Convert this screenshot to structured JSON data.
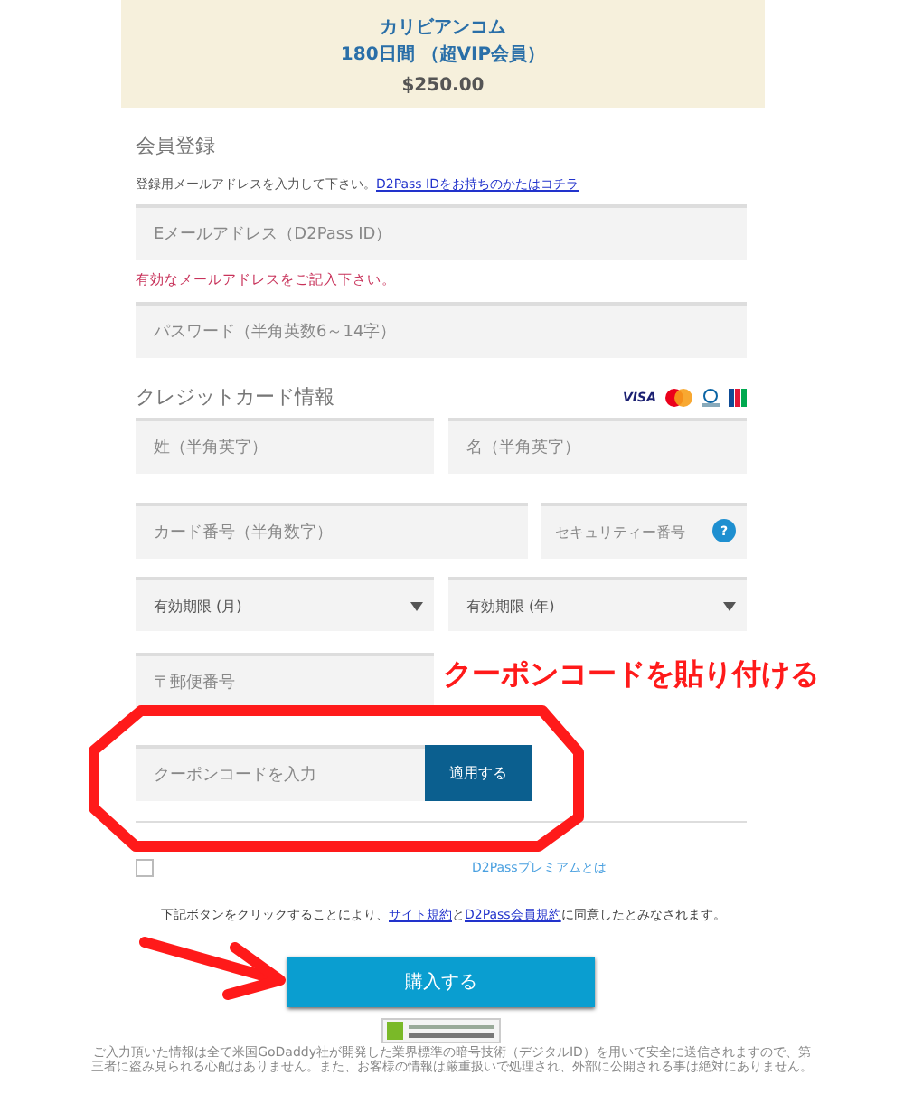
{
  "plan": {
    "site": "カリビアンコム",
    "term": "180日間 （超VIP会員）",
    "price": "$250.00"
  },
  "register": {
    "heading": "会員登録",
    "hint": "登録用メールアドレスを入力して下さい。",
    "hint_link": "D2Pass IDをお持ちのかたはコチラ",
    "email": {
      "placeholder": "Eメールアドレス（D2Pass ID）"
    },
    "error": "有効なメールアドレスをご記入下さい。",
    "password": {
      "placeholder": "パスワード（半角英数6～14字）"
    }
  },
  "card": {
    "heading": "クレジットカード情報",
    "visa": "VISA",
    "last_name": {
      "placeholder": "姓（半角英字）"
    },
    "first_name": {
      "placeholder": "名（半角英字）"
    },
    "number": {
      "placeholder": "カード番号（半角数字）"
    },
    "security": {
      "placeholder": "セキュリティー番号"
    },
    "help": "?",
    "month": {
      "placeholder": "有効期限 (月)"
    },
    "year": {
      "placeholder": "有効期限 (年)"
    },
    "postal": {
      "placeholder": "〒郵便番号"
    }
  },
  "coupon": {
    "placeholder": "クーポンコードを入力",
    "button": "適用する"
  },
  "premium": {
    "checked": false,
    "link": "D2Passプレミアムとは"
  },
  "agreement": {
    "before": "下記ボタンをクリックすることにより、",
    "link1": "サイト規約",
    "mid": "と",
    "link2": "D2Pass会員規約",
    "after": "に同意したとみなされます。"
  },
  "buy_button": "購入する",
  "footer": "ご入力頂いた情報は全て米国GoDaddy社が開発した業界標準の暗号技術（デジタルID）を用いて安全に送信されますので、第三者に盗み見られる心配はありません。また、お客様の情報は厳重扱いで処理され、外部に公開される事は絶対にありません。",
  "annotation": {
    "text": "クーポンコードを貼り付ける"
  }
}
